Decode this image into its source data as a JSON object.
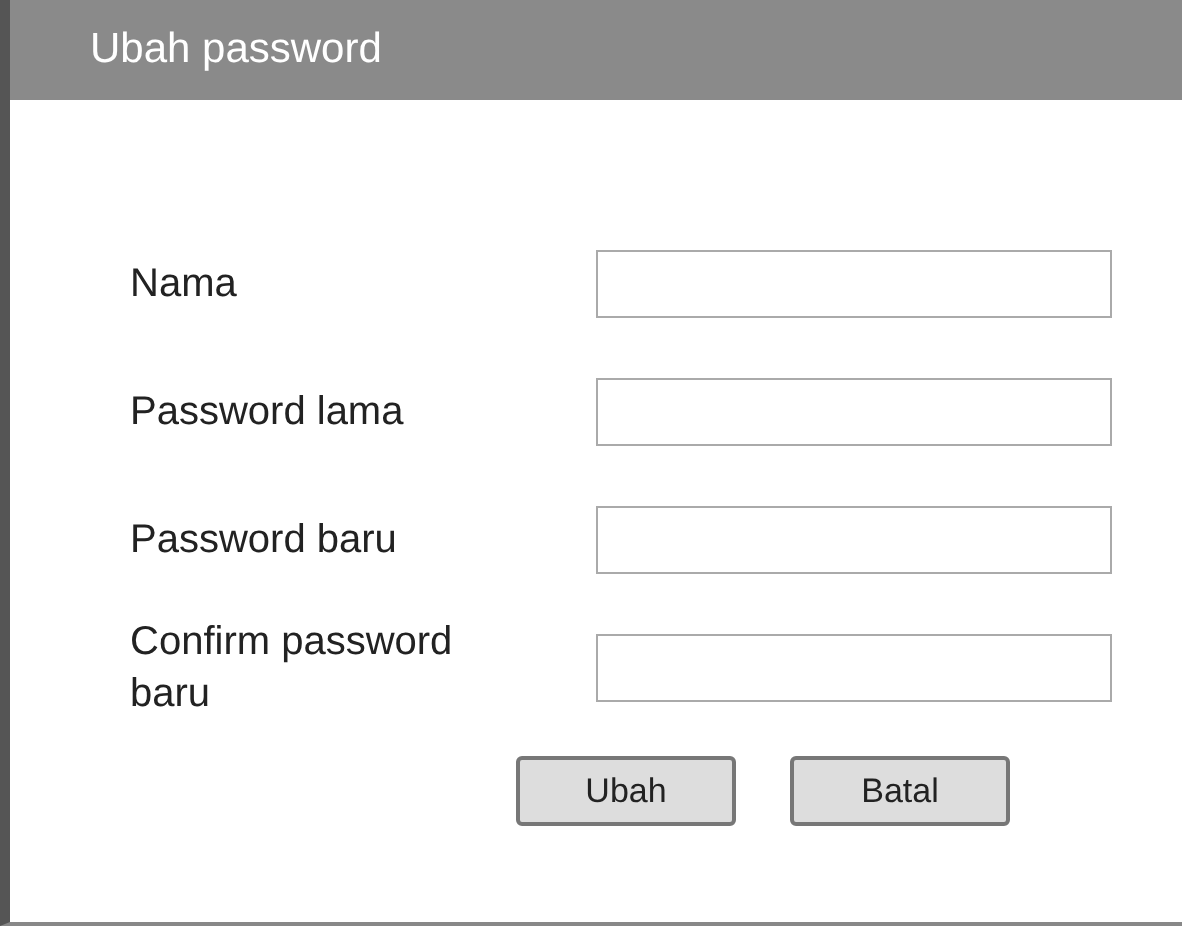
{
  "window": {
    "title": "Ubah password"
  },
  "fields": [
    {
      "label": "Nama"
    },
    {
      "label": "Password lama"
    },
    {
      "label": "Password baru"
    },
    {
      "label": "Confirm password baru"
    }
  ],
  "buttons": [
    "Ubah",
    "Batal"
  ]
}
